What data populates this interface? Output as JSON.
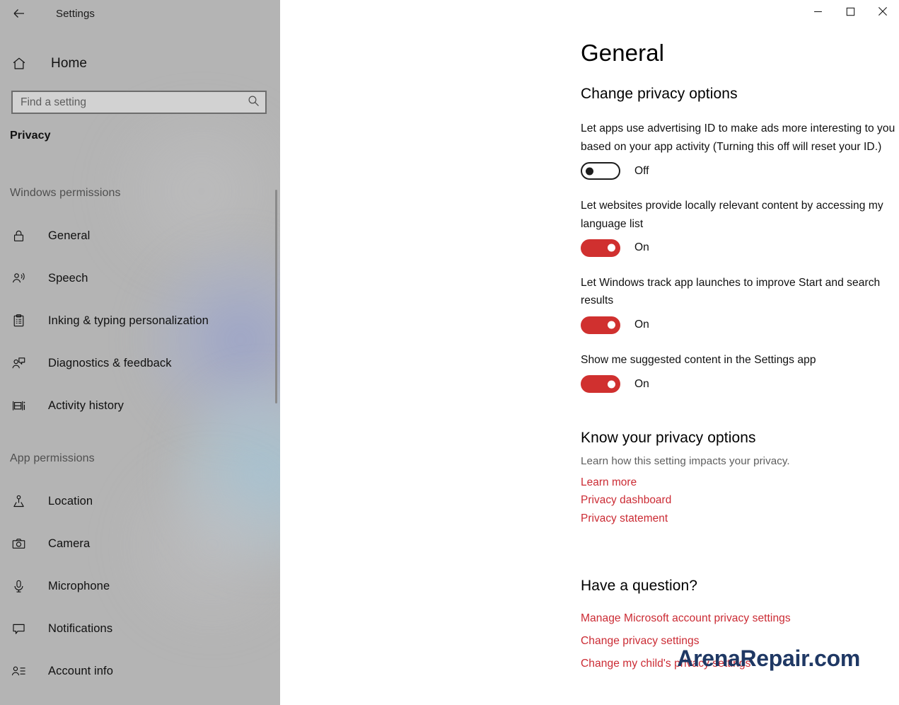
{
  "window": {
    "app_title": "Settings",
    "back_icon": "back-arrow-icon",
    "controls": {
      "minimize": "minimize-icon",
      "maximize": "maximize-icon",
      "close": "close-icon"
    }
  },
  "sidebar": {
    "home": {
      "label": "Home",
      "icon": "home-icon"
    },
    "search": {
      "placeholder": "Find a setting",
      "value": "",
      "icon": "search-icon"
    },
    "category_title": "Privacy",
    "groups": [
      {
        "header": "Windows permissions",
        "items": [
          {
            "label": "General",
            "icon": "lock-icon",
            "selected": true
          },
          {
            "label": "Speech",
            "icon": "speech-person-icon",
            "selected": false
          },
          {
            "label": "Inking & typing personalization",
            "icon": "clipboard-icon",
            "selected": false
          },
          {
            "label": "Diagnostics & feedback",
            "icon": "feedback-person-icon",
            "selected": false
          },
          {
            "label": "Activity history",
            "icon": "timeline-icon",
            "selected": false
          }
        ]
      },
      {
        "header": "App permissions",
        "items": [
          {
            "label": "Location",
            "icon": "location-pin-icon",
            "selected": false
          },
          {
            "label": "Camera",
            "icon": "camera-icon",
            "selected": false
          },
          {
            "label": "Microphone",
            "icon": "microphone-icon",
            "selected": false
          },
          {
            "label": "Notifications",
            "icon": "notification-bubble-icon",
            "selected": false
          },
          {
            "label": "Account info",
            "icon": "account-info-icon",
            "selected": false
          }
        ]
      }
    ]
  },
  "main": {
    "page_title": "General",
    "section_change_privacy": "Change privacy options",
    "settings": [
      {
        "description": "Let apps use advertising ID to make ads more interesting to you based on your app activity (Turning this off will reset your ID.)",
        "state_label": "Off",
        "on": false
      },
      {
        "description": "Let websites provide locally relevant content by accessing my language list",
        "state_label": "On",
        "on": true
      },
      {
        "description": "Let Windows track app launches to improve Start and search results",
        "state_label": "On",
        "on": true
      },
      {
        "description": "Show me suggested content in the Settings app",
        "state_label": "On",
        "on": true
      }
    ],
    "section_know_privacy": {
      "heading": "Know your privacy options",
      "note": "Learn how this setting impacts your privacy.",
      "links": [
        "Learn more",
        "Privacy dashboard",
        "Privacy statement"
      ]
    },
    "section_question": {
      "heading": "Have a question?",
      "links": [
        "Manage Microsoft account privacy settings",
        "Change privacy settings",
        "Change my child's privacy settings"
      ]
    }
  },
  "watermark": {
    "text": "ArenaRepair.com"
  },
  "colors": {
    "accent_red": "#d0302f",
    "link_red": "#cb2a33",
    "sidebar_bg": "#b4b4b4",
    "watermark_navy": "#1f3864"
  }
}
